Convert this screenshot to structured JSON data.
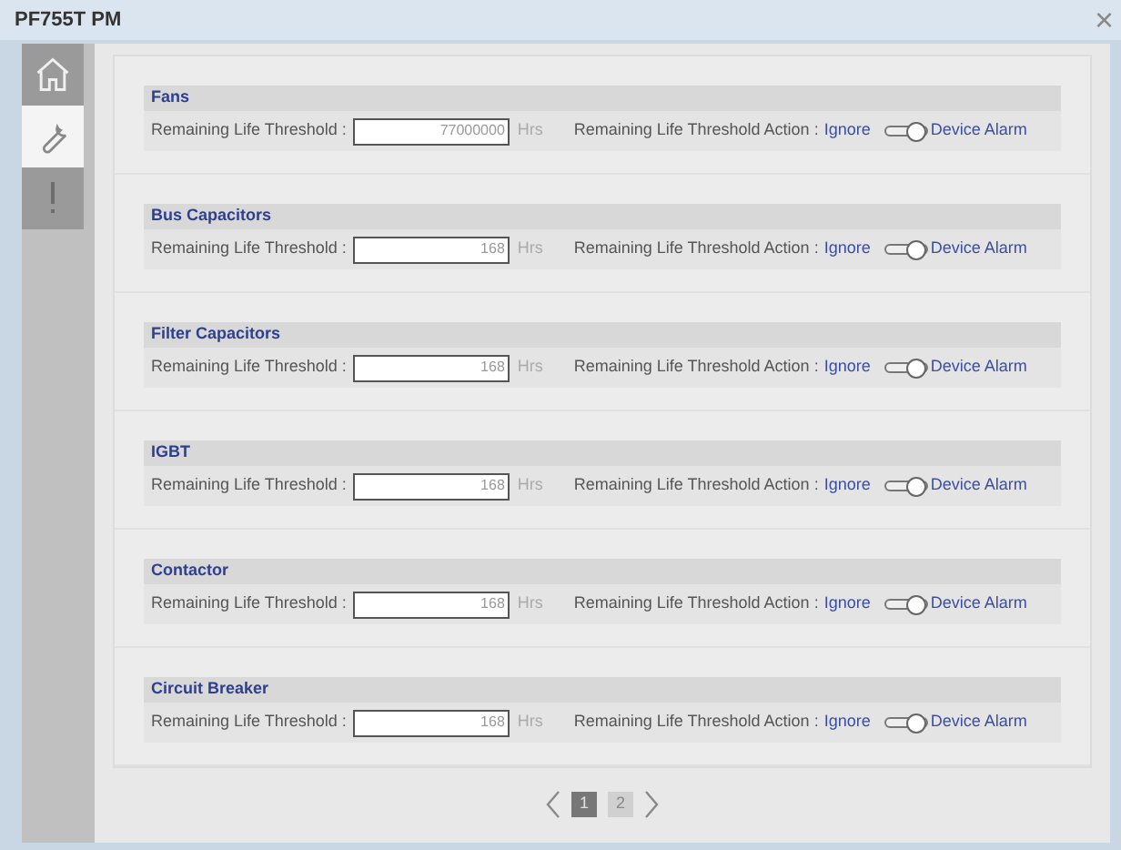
{
  "window": {
    "title": "PF755T PM",
    "close": "×"
  },
  "sidebar": {
    "tabs": [
      {
        "kind": "home",
        "selected": false
      },
      {
        "kind": "wrench",
        "selected": true
      },
      {
        "kind": "alert",
        "selected": false
      }
    ]
  },
  "sections": [
    {
      "title": "Fans",
      "label": "Remaining Life Threshold :",
      "value": "77000000",
      "unit": "Hrs",
      "action_label": "Remaining Life Threshold Action :",
      "off_label": "Ignore",
      "on_label": "Device Alarm",
      "on": true
    },
    {
      "title": "Bus Capacitors",
      "label": "Remaining Life Threshold :",
      "value": "168",
      "unit": "Hrs",
      "action_label": "Remaining Life Threshold Action :",
      "off_label": "Ignore",
      "on_label": "Device Alarm",
      "on": true
    },
    {
      "title": "Filter Capacitors",
      "label": "Remaining Life Threshold :",
      "value": "168",
      "unit": "Hrs",
      "action_label": "Remaining Life Threshold Action :",
      "off_label": "Ignore",
      "on_label": "Device Alarm",
      "on": true
    },
    {
      "title": "IGBT",
      "label": "Remaining Life Threshold :",
      "value": "168",
      "unit": "Hrs",
      "action_label": "Remaining Life Threshold Action :",
      "off_label": "Ignore",
      "on_label": "Device Alarm",
      "on": true
    },
    {
      "title": "Contactor",
      "label": "Remaining Life Threshold :",
      "value": "168",
      "unit": "Hrs",
      "action_label": "Remaining Life Threshold Action :",
      "off_label": "Ignore",
      "on_label": "Device Alarm",
      "on": true
    },
    {
      "title": "Circuit Breaker",
      "label": "Remaining Life Threshold :",
      "value": "168",
      "unit": "Hrs",
      "action_label": "Remaining Life Threshold Action :",
      "off_label": "Ignore",
      "on_label": "Device Alarm",
      "on": true
    }
  ],
  "pager": {
    "pages": [
      {
        "label": "1",
        "selected": true
      },
      {
        "label": "2",
        "selected": false
      }
    ]
  }
}
